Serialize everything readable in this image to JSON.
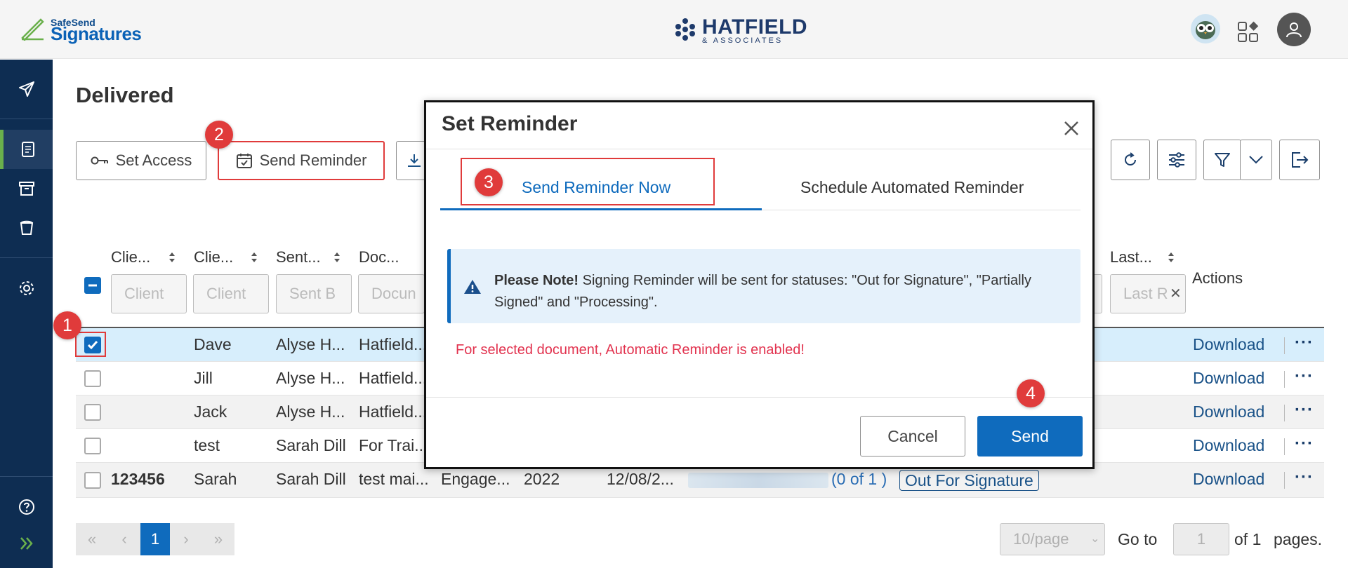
{
  "app": {
    "brand_top": "SafeSend",
    "brand_name": "Signatures",
    "company_name": "HATFIELD",
    "company_sub": "& ASSOCIATES"
  },
  "page": {
    "title": "Delivered"
  },
  "toolbar": {
    "set_access": "Set Access",
    "send_reminder": "Send Reminder"
  },
  "table": {
    "headers": [
      "Clie...",
      "Clie...",
      "Sent...",
      "Doc...",
      "Last...",
      "Actions"
    ],
    "filters": [
      "Client",
      "Client",
      "Sent B",
      "Docun",
      "Last R"
    ],
    "rows": [
      {
        "id": "",
        "name": "Dave",
        "sent_by": "Alyse H...",
        "doc": "Hatfield...",
        "checked": true
      },
      {
        "id": "",
        "name": "Jill",
        "sent_by": "Alyse H...",
        "doc": "Hatfield...",
        "checked": false
      },
      {
        "id": "",
        "name": "Jack",
        "sent_by": "Alyse H...",
        "doc": "Hatfield...",
        "checked": false
      },
      {
        "id": "",
        "name": "test",
        "sent_by": "Sarah Dill",
        "doc": "For Trai...",
        "checked": false
      },
      {
        "id": "123456",
        "name": "Sarah",
        "sent_by": "Sarah Dill",
        "doc": "test mai...",
        "type": "Engage...",
        "year": "2022",
        "date": "12/08/2...",
        "count": "(0 of 1 )",
        "status": "Out For Signature",
        "checked": false
      }
    ],
    "action_label": "Download"
  },
  "pagination": {
    "current": "1",
    "per_page": "10/page",
    "go_to": "Go to",
    "go_value": "1",
    "of": "of 1",
    "pages": "pages."
  },
  "modal": {
    "title": "Set Reminder",
    "tab_now": "Send Reminder Now",
    "tab_schedule": "Schedule Automated Reminder",
    "note_bold": "Please Note!",
    "note_text": " Signing Reminder will be sent for statuses: \"Out for Signature\", \"Partially Signed\" and \"Processing\".",
    "warning": "For selected document, Automatic Reminder is enabled!",
    "cancel": "Cancel",
    "send": "Send"
  },
  "annotations": [
    "1",
    "2",
    "3",
    "4"
  ]
}
